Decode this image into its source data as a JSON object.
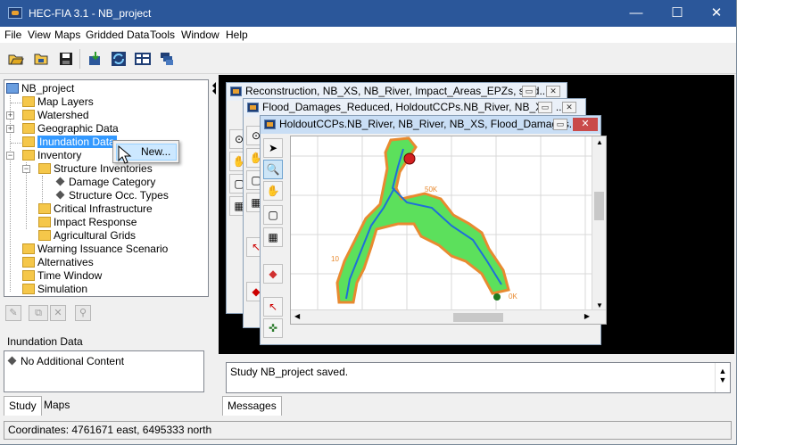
{
  "window": {
    "title": "HEC-FIA 3.1 - NB_project",
    "minimize": "—",
    "maximize": "☐",
    "close": "✕"
  },
  "menu": [
    "File",
    "View",
    "Maps",
    "Gridded Data",
    "Tools",
    "Window",
    "Help"
  ],
  "toolbar": {
    "icons": [
      "open-folder-icon",
      "open-project-icon",
      "save-icon",
      "import-icon",
      "compute-icon",
      "table-icon",
      "layers-icon"
    ]
  },
  "tree": {
    "root": "NB_project",
    "items": [
      "Map Layers",
      "Watershed",
      "Geographic Data",
      "Inundation Data",
      "Inventory",
      "Structure Inventories",
      "Damage Category",
      "Structure Occ. Types",
      "Critical Infrastructure",
      "Impact Response",
      "Agricultural Grids",
      "Warning Issuance Scenario",
      "Alternatives",
      "Time Window",
      "Simulation"
    ]
  },
  "context_menu": {
    "item": "New..."
  },
  "left_panel": {
    "label": "Inundation Data",
    "content": "No Additional Content"
  },
  "left_tabs": [
    "Study",
    "Maps"
  ],
  "map_windows": [
    {
      "title": "Reconstruction, NB_XS, NB_River, Impact_Areas_EPZs, stud..."
    },
    {
      "title": "Flood_Damages_Reduced, HoldoutCCPs.NB_River, NB_XS, ..."
    },
    {
      "title": "HoldoutCCPs.NB_River, NB_River, NB_XS, Flood_Damages..."
    }
  ],
  "map_labels": {
    "station_50k": "50K",
    "station_0k": "0K",
    "station_10": "10"
  },
  "map_tools": [
    "select-arrow-icon",
    "zoom-icon",
    "pan-hand-icon",
    "info-icon",
    "grid-info-icon",
    "shape-icon",
    "edit-arrow-icon",
    "locator-icon"
  ],
  "messages": {
    "text": "Study NB_project saved."
  },
  "right_tabs": [
    "Messages"
  ],
  "status": {
    "coordinates": "Coordinates: 4761671 east, 6495333 north"
  },
  "colors": {
    "titlebar": "#2b579a",
    "selection": "#3399ff",
    "flood_green": "#5ce05c",
    "river_orange": "#e88a30",
    "marker_red": "#d42020"
  }
}
